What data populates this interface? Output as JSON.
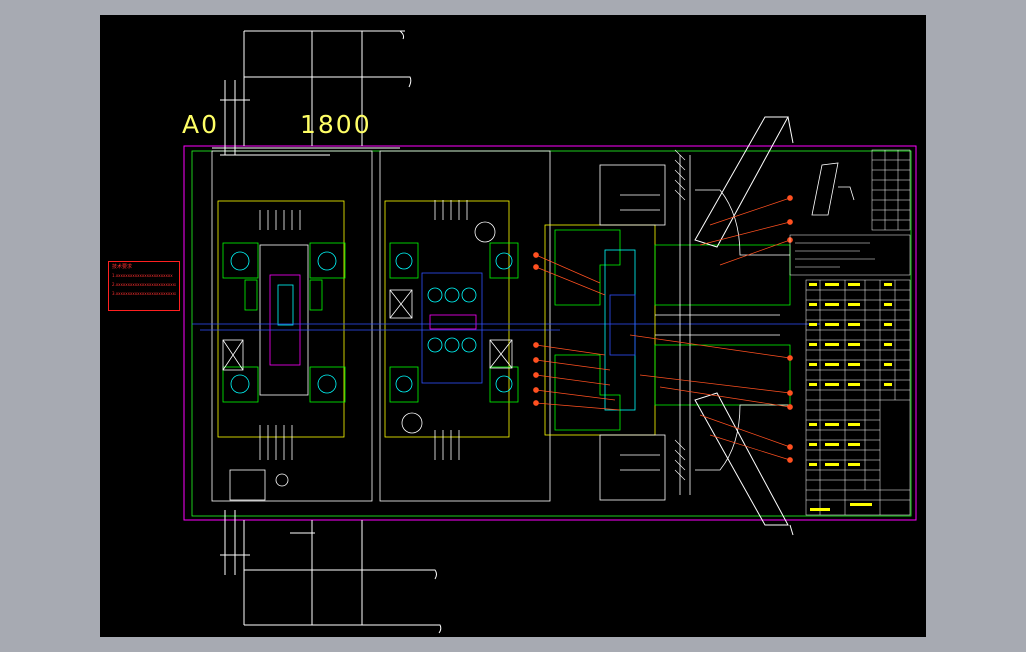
{
  "window": {
    "background": "#a7aab2",
    "canvas_background": "#000000"
  },
  "sheet": {
    "size_label": "A0",
    "scale_label": "1800",
    "label_color": "#ffff66",
    "border_color": "#ff00ff",
    "frame_color": "#22ff22"
  },
  "notes": {
    "title": "技术要求",
    "lines": [
      "1.xxxxxxxxxxxxxxxxxxxxxxxx",
      "2.xxxxxxxxxxxxxxxxxxxxxxxxxx xxxxxxxxxxxxxxxxxxxxxx",
      "3.xxxxxxxxxxxxxxxxxxxxxxxxxx xxxxxxxxxxxxxxxxxxxxxx"
    ],
    "color": "#ff2020"
  },
  "colors": {
    "white": "#ffffff",
    "yellow": "#ffff00",
    "green": "#00ff00",
    "cyan": "#00ffff",
    "blue": "#3050ff",
    "magenta": "#ff00ff",
    "red": "#ff3020",
    "orange": "#ff8020"
  }
}
